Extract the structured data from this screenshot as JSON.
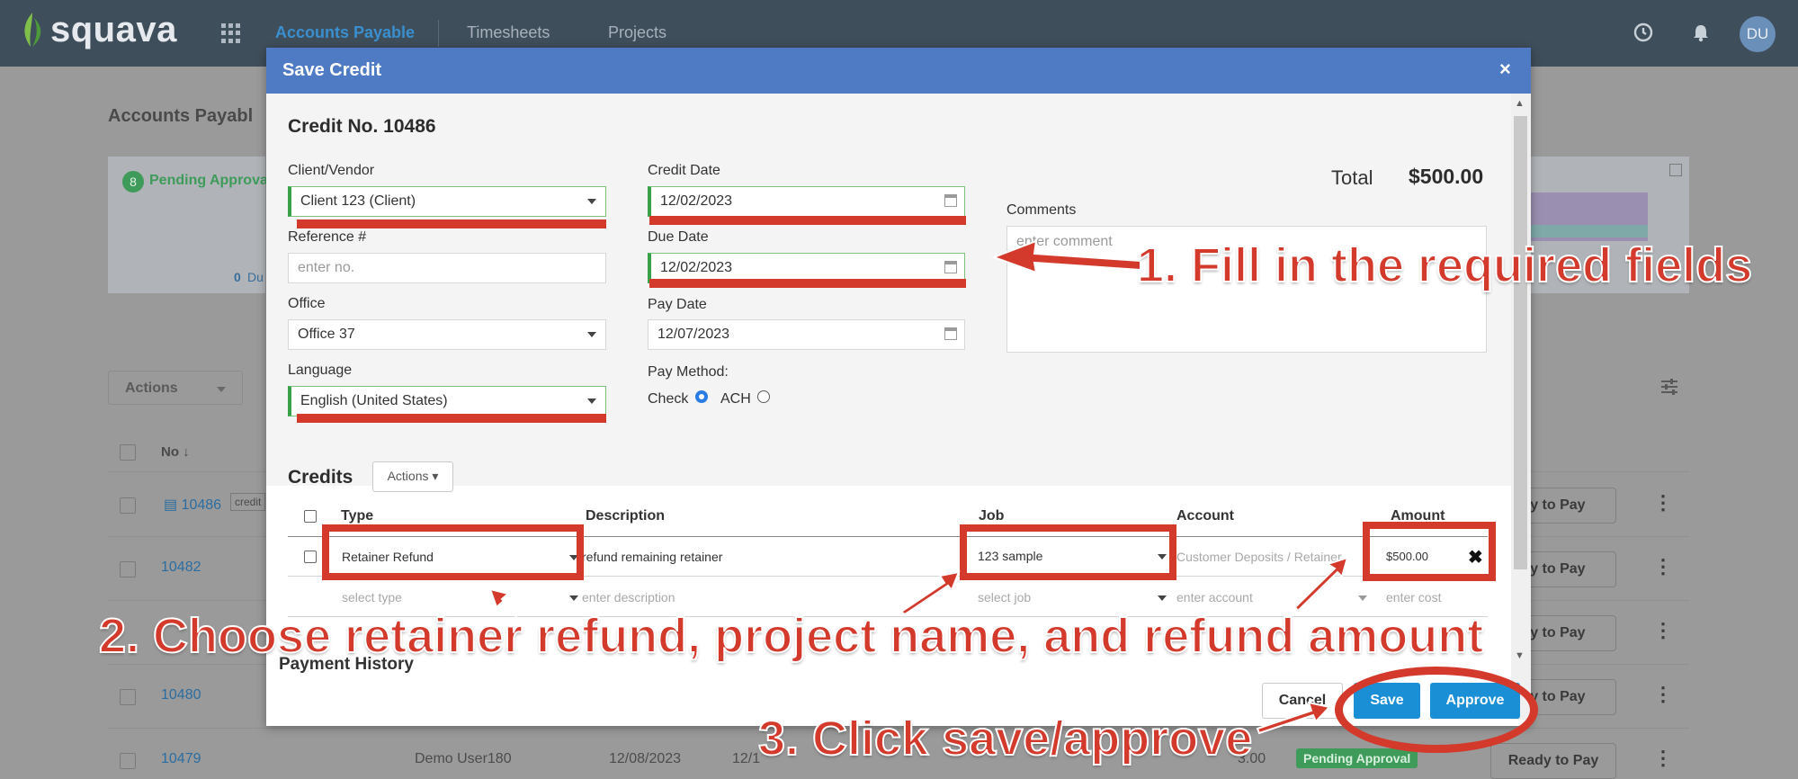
{
  "app": {
    "logo_text": "squava",
    "nav_tabs": [
      "Accounts Payable",
      "Timesheets",
      "Projects"
    ],
    "avatar": "DU"
  },
  "background": {
    "page_title": "Accounts Payabl",
    "card_label": "Pending Approva",
    "card_badge": "8",
    "card_footer": "0",
    "card_footer_suffix": "Du",
    "actions_label": "Actions",
    "col_no": "No",
    "rows": [
      {
        "no": "10486",
        "tag": "credit",
        "btn": "dy to Pay"
      },
      {
        "no": "10482",
        "btn": "dy to Pay"
      },
      {
        "no": "",
        "btn": "dy to Pay"
      },
      {
        "no": "10480",
        "btn": "dy to Pay"
      },
      {
        "no": "10479",
        "user": "Demo User180",
        "date1": "12/08/2023",
        "date2": "12/1",
        "amount": "3.00",
        "status": "Pending Approval",
        "btn": "Ready to Pay"
      }
    ]
  },
  "modal": {
    "title": "Save Credit",
    "close": "×",
    "credit_no": "Credit No. 10486",
    "client_vendor_label": "Client/Vendor",
    "client_vendor_value": "Client 123 (Client)",
    "reference_label": "Reference #",
    "reference_placeholder": "enter no.",
    "office_label": "Office",
    "office_value": "Office 37",
    "language_label": "Language",
    "language_value": "English (United States)",
    "credit_date_label": "Credit Date",
    "credit_date_value": "12/02/2023",
    "due_date_label": "Due Date",
    "due_date_value": "12/02/2023",
    "pay_date_label": "Pay Date",
    "pay_date_value": "12/07/2023",
    "pay_method_label": "Pay Method:",
    "pay_method_check": "Check",
    "pay_method_ach": "ACH",
    "total_label": "Total",
    "total_value": "$500.00",
    "comments_label": "Comments",
    "comments_placeholder": "enter comment",
    "credits_title": "Credits",
    "credits_actions": "Actions",
    "table_headers": [
      "Type",
      "Description",
      "Job",
      "Account",
      "Amount"
    ],
    "row1": {
      "type": "Retainer Refund",
      "description": "refund remaining retainer",
      "job": "123 sample",
      "account": "Customer Deposits / Retainer",
      "amount": "$500.00"
    },
    "row2": {
      "type": "select type",
      "description": "enter description",
      "job": "select job",
      "account": "enter account",
      "amount": "enter cost"
    },
    "payment_history": "Payment History",
    "cancel": "Cancel",
    "save": "Save",
    "approve": "Approve"
  },
  "annotations": {
    "step1": "1. Fill in the required fields",
    "step2": "2. Choose retainer refund, project name, and refund amount",
    "step3": "3. Click save/approve"
  },
  "colors": {
    "nav_bg": "#3f4e5b",
    "modal_header": "#4e7bc4",
    "primary_button": "#1a8fd6",
    "annotation_red": "#d33a2c",
    "required_green": "#3aa14a"
  }
}
